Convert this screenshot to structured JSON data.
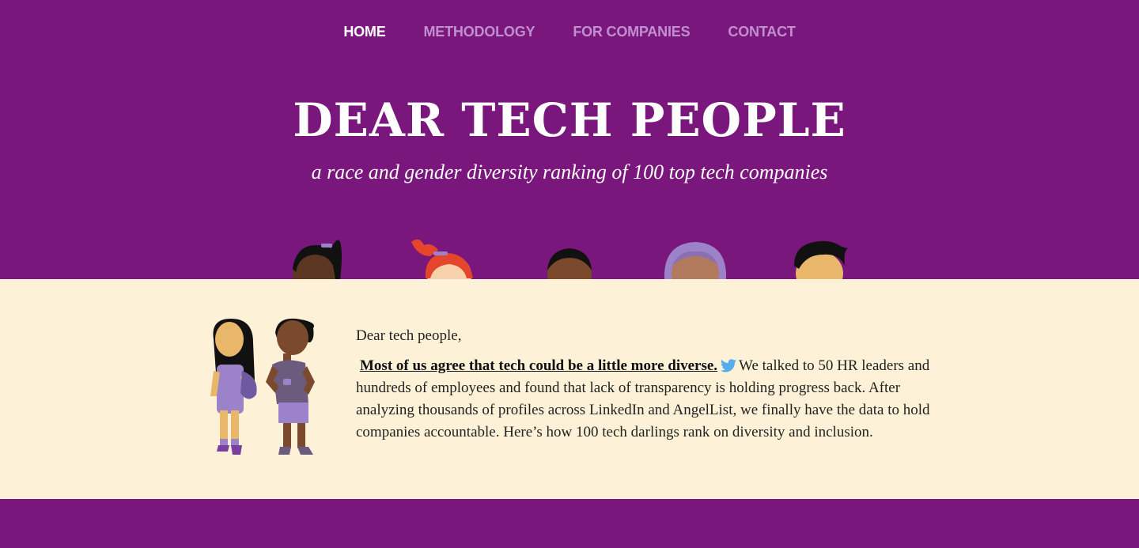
{
  "nav": {
    "items": [
      {
        "label": "HOME",
        "active": true
      },
      {
        "label": "METHODOLOGY",
        "active": false
      },
      {
        "label": "FOR COMPANIES",
        "active": false
      },
      {
        "label": "CONTACT",
        "active": false
      }
    ]
  },
  "hero": {
    "title": "DEAR TECH PEOPLE",
    "subtitle": "a race and gender diversity ranking of 100 top tech companies"
  },
  "letter": {
    "greeting": "Dear tech people,",
    "highlight": "Most of us agree that tech could be a little more diverse.",
    "body": "We talked to 50 HR leaders and hundreds of employees and found that lack of transparency is holding progress back. After analyzing thousands of profiles across LinkedIn and AngelList, we finally have the data to hold companies accountable. Here’s how 100 tech darlings rank on diversity and inclusion."
  },
  "icons": {
    "share": "twitter-bird-icon"
  },
  "colors": {
    "brand_purple": "#7a177c",
    "nav_inactive": "#c08fd0",
    "cream": "#fdf1d7",
    "twitter_blue": "#55acee"
  }
}
